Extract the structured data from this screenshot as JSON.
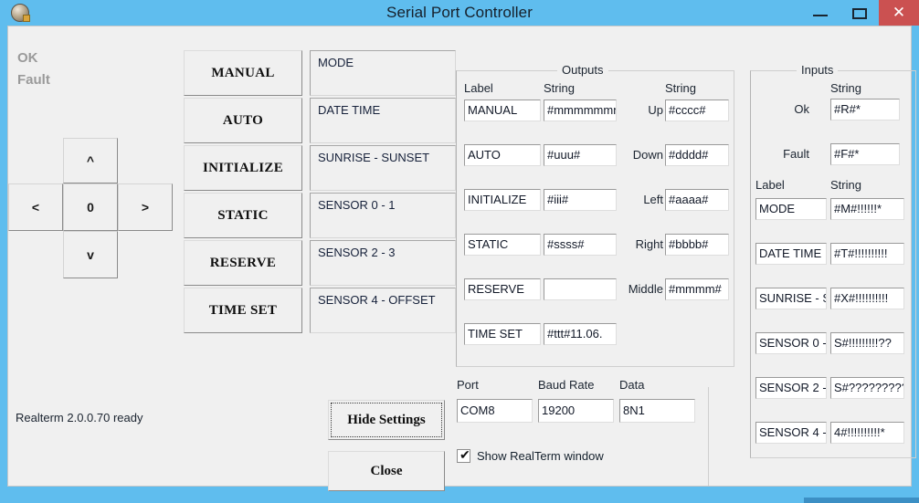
{
  "window": {
    "title": "Serial Port Controller",
    "icon": "app-icon",
    "minimize_label": "–",
    "maximize_label": "❑",
    "close_label": "✕",
    "titlebar_color": "#5fbdee",
    "close_button_color": "#cb5151"
  },
  "status_leds": {
    "ok": "OK",
    "fault": "Fault"
  },
  "dpad": {
    "up": "^",
    "left": "<",
    "middle": "0",
    "right": ">",
    "down": "v"
  },
  "commands": [
    {
      "label": "MANUAL"
    },
    {
      "label": "AUTO"
    },
    {
      "label": "INITIALIZE"
    },
    {
      "label": "STATIC"
    },
    {
      "label": "RESERVE"
    },
    {
      "label": "TIME SET"
    }
  ],
  "displays": [
    {
      "text": "MODE"
    },
    {
      "text": "DATE TIME"
    },
    {
      "text": "SUNRISE - SUNSET"
    },
    {
      "text": "SENSOR 0 - 1"
    },
    {
      "text": "SENSOR 2 - 3"
    },
    {
      "text": "SENSOR 4 - OFFSET"
    }
  ],
  "outputs": {
    "group_title": "Outputs",
    "col_label": "Label",
    "col_string": "String",
    "col_string2": "String",
    "rows": [
      {
        "label": "MANUAL",
        "string": "#mmmmmmm"
      },
      {
        "label": "AUTO",
        "string": "#uuu#"
      },
      {
        "label": "INITIALIZE",
        "string": "#iii#"
      },
      {
        "label": "STATIC",
        "string": "#ssss#"
      },
      {
        "label": "RESERVE",
        "string": ""
      },
      {
        "label": "TIME SET",
        "string": "#ttt#11.06."
      }
    ],
    "direction_rows": [
      {
        "label": "Up",
        "string": "#cccc#"
      },
      {
        "label": "Down",
        "string": "#dddd#"
      },
      {
        "label": "Left",
        "string": "#aaaa#"
      },
      {
        "label": "Right",
        "string": "#bbbb#"
      },
      {
        "label": "Middle",
        "string": "#mmmm#"
      }
    ]
  },
  "inputs": {
    "group_title": "Inputs",
    "col_string_top": "String",
    "col_label": "Label",
    "col_string": "String",
    "status_rows": [
      {
        "label": "Ok",
        "string": "#R#*"
      },
      {
        "label": "Fault",
        "string": "#F#*"
      }
    ],
    "rows": [
      {
        "label": "MODE",
        "string": "#M#!!!!!!*"
      },
      {
        "label": "DATE TIME",
        "string": "#T#!!!!!!!!!!"
      },
      {
        "label": "SUNRISE - S",
        "string": "#X#!!!!!!!!!!"
      },
      {
        "label": "SENSOR 0 - ",
        "string": "S#!!!!!!!!!??"
      },
      {
        "label": "SENSOR 2 - ",
        "string": "S#?????????"
      },
      {
        "label": "SENSOR 4 - ",
        "string": "4#!!!!!!!!!!*"
      }
    ]
  },
  "serial": {
    "port_label": "Port",
    "port_value": "COM8",
    "baud_label": "Baud Rate",
    "baud_value": "19200",
    "data_label": "Data",
    "data_value": "8N1"
  },
  "buttons": {
    "hide_settings": "Hide Settings",
    "close": "Close"
  },
  "checkbox": {
    "label": "Show RealTerm window",
    "checked_glyph": "✔"
  },
  "status_bar": {
    "text": "Realterm  2.0.0.70 ready"
  }
}
